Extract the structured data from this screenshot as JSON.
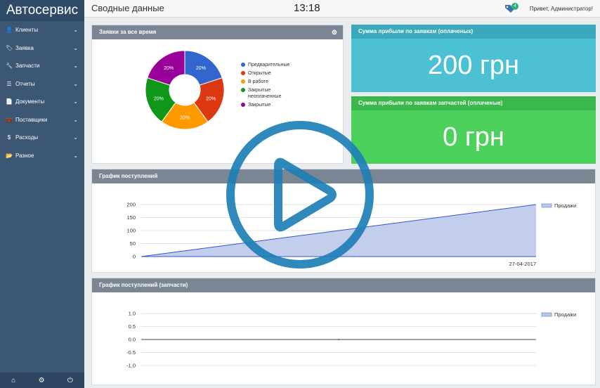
{
  "sidebar": {
    "brand": "Автосервис",
    "items": [
      {
        "label": "Клиенты",
        "icon": "user-icon",
        "glyph": "👤"
      },
      {
        "label": "Заявка",
        "icon": "tag-icon",
        "glyph": "🏷"
      },
      {
        "label": "Запчасти",
        "icon": "wrench-icon",
        "glyph": "🔧"
      },
      {
        "label": "Отчеты",
        "icon": "list-icon",
        "glyph": "☰"
      },
      {
        "label": "Документы",
        "icon": "document-icon",
        "glyph": "📄"
      },
      {
        "label": "Поставщики",
        "icon": "briefcase-icon",
        "glyph": "💼"
      },
      {
        "label": "Расходы",
        "icon": "dollar-icon",
        "glyph": "$"
      },
      {
        "label": "Разное",
        "icon": "folder-icon",
        "glyph": "📂"
      }
    ],
    "footer": {
      "home": "⌂",
      "settings": "⚙",
      "power": "⏻"
    }
  },
  "header": {
    "title": "Сводные данные",
    "clock": "13:18",
    "badge": "4",
    "greeting": "Привет, Администратор!"
  },
  "pie_panel": {
    "title": "Заявки за все время",
    "gear": "⚙"
  },
  "profit_panel": {
    "title": "Сумма прибыли по заявкам (оплаченых)",
    "value": "200 грн"
  },
  "parts_panel": {
    "title": "Сумма прибыли по заявкам запчастей (оплаченые)",
    "value": "0 грн"
  },
  "chart1_panel": {
    "title": "График поступлений"
  },
  "chart2_panel": {
    "title": "График поступлений (запчасти)"
  },
  "colors": {
    "sidebar": "#3b5773",
    "pie": [
      "#3366cc",
      "#dc3912",
      "#ff9900",
      "#109618",
      "#990099"
    ],
    "area_fill": "#b8c6ea",
    "area_line": "#3357c8"
  },
  "chart_data": [
    {
      "type": "pie",
      "title": "Заявки за все время",
      "labels": [
        "Предварительные",
        "Открытые",
        "В работе",
        "Закрытые неоплаченные",
        "Закрытые"
      ],
      "values": [
        20,
        20,
        20,
        20,
        20
      ],
      "data_labels": [
        "20%",
        "20%",
        "20%",
        "20%",
        "20%"
      ]
    },
    {
      "type": "area",
      "title": "График поступлений",
      "x": [
        "",
        "27-04-2017"
      ],
      "series": [
        {
          "name": "Продажи",
          "values": [
            0,
            200
          ]
        }
      ],
      "yticks": [
        "0",
        "50",
        "100",
        "150",
        "200"
      ],
      "ylim": [
        0,
        200
      ],
      "legend": "top-right",
      "grid": true
    },
    {
      "type": "line",
      "title": "График поступлений (запчасти)",
      "series": [
        {
          "name": "Продажи",
          "values": [
            0
          ]
        }
      ],
      "yticks": [
        "-1.0",
        "-0.5",
        "0.0",
        "0.5",
        "1.0"
      ],
      "ylim": [
        -1,
        1
      ],
      "legend": "top-right",
      "grid": true
    }
  ]
}
